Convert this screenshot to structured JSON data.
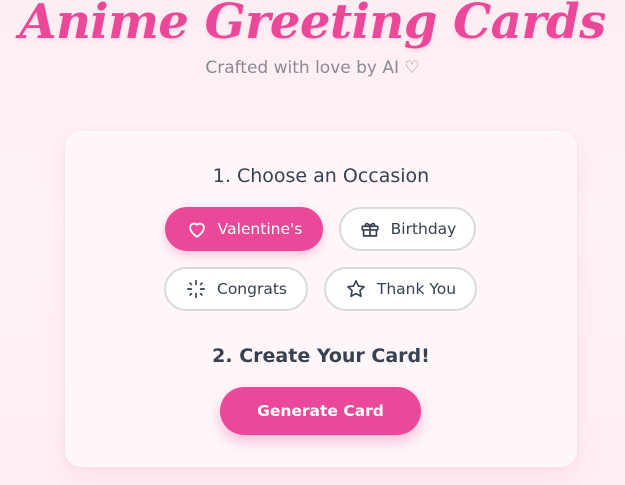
{
  "header": {
    "title": "Anime Greeting Cards",
    "subtitle": "Crafted with love by AI ♡"
  },
  "occasion": {
    "heading": "1. Choose an Occasion",
    "selected": "Valentine's",
    "options": [
      {
        "label": "Valentine's",
        "icon": "heart-icon"
      },
      {
        "label": "Birthday",
        "icon": "gift-icon"
      },
      {
        "label": "Congrats",
        "icon": "sparkles-icon"
      },
      {
        "label": "Thank You",
        "icon": "star-icon"
      }
    ]
  },
  "create": {
    "heading": "2. Create Your Card!",
    "button_label": "Generate Card"
  },
  "colors": {
    "accent": "#ec4899",
    "text": "#374151",
    "subtle_text": "#8a8a93",
    "card_bg": "#fff7fa"
  }
}
